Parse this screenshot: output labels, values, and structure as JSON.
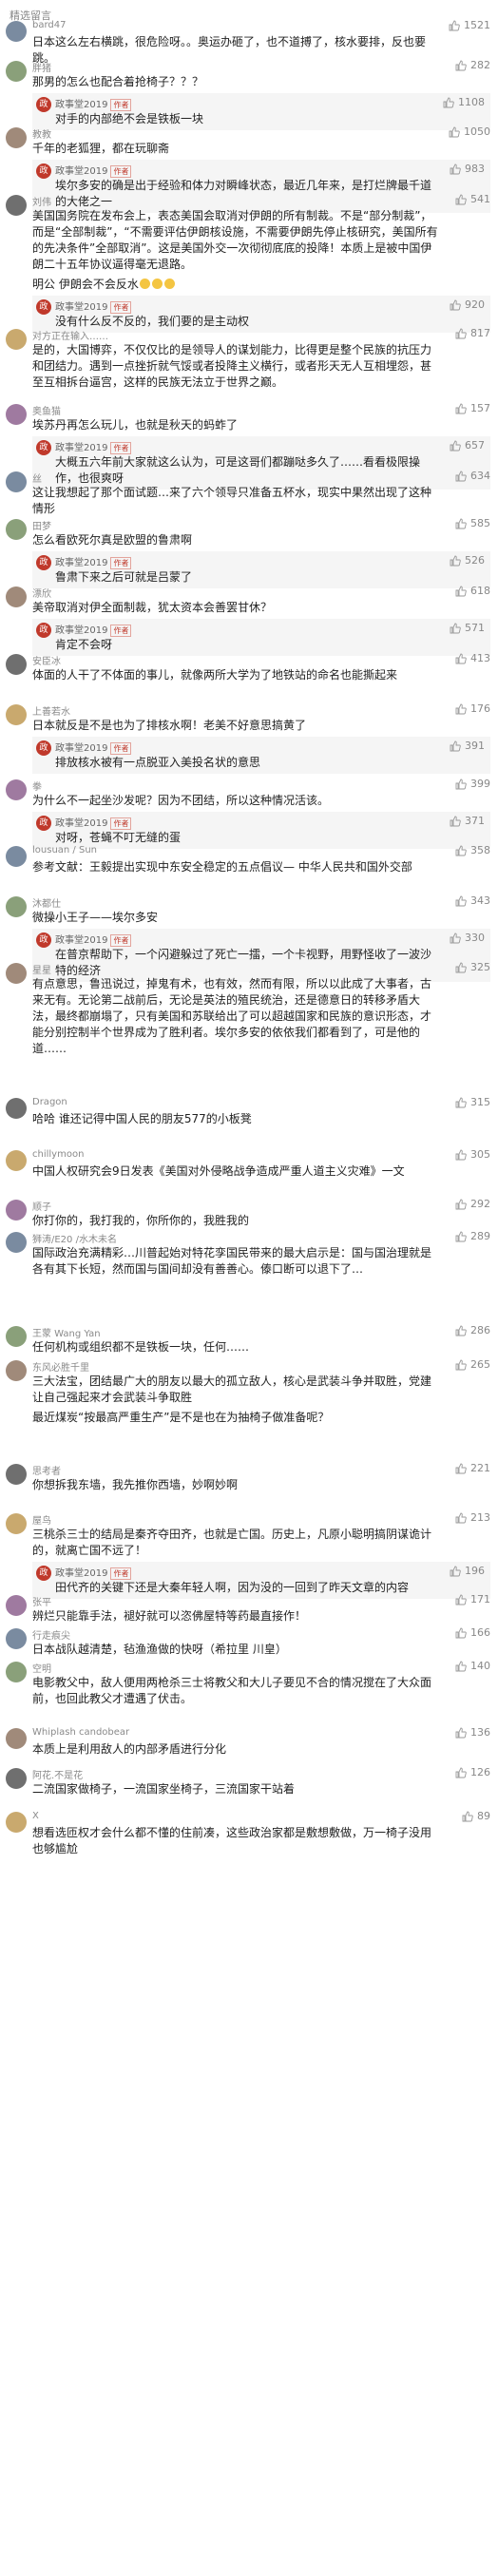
{
  "header": {
    "title": "精选留言"
  },
  "reply_author": {
    "name": "政事堂2019",
    "badge": "作者",
    "avatar_glyph": "政"
  },
  "icons": {
    "like": "thumb-up-icon",
    "emoji": "laugh-emoji"
  },
  "comments": [
    {
      "user": "bard47",
      "likes": "1521",
      "text": "日本这么左右横跳，很危险呀。。奥运办砸了，也不道搏了，核水要排，反也要跳。"
    },
    {
      "user": "胖猪",
      "likes": "282",
      "text": "那男的怎么也配合着抢椅子？？？",
      "reply": {
        "likes": "1108",
        "text": "对手的内部绝不会是铁板一块"
      }
    },
    {
      "user": "教教",
      "likes": "1050",
      "text": "千年的老狐狸，都在玩聊斋",
      "reply": {
        "likes": "983",
        "text": "埃尔多安的确是出于经验和体力对瞬峰状态，最近几年来，是打烂牌最千道的大佬之一"
      }
    },
    {
      "user": "刘伟",
      "likes": "541",
      "text": "美国国务院在发布会上，表态美国会取消对伊朗的所有制裁。不是“部分制裁”，而是“全部制裁”，“不需要评估伊朗核设施，不需要伊朗先停止核研究，美国所有的先决条件”全部取消”。这是美国外交一次彻彻底底的投降！本质上是被中国伊朗二十五年协议逼得毫无退路。",
      "text2": "明公  伊朗会不会反水",
      "reply": {
        "likes": "920",
        "text": "没有什么反不反的，我们要的是主动权"
      }
    },
    {
      "user": "对方正在输入……",
      "likes": "817",
      "text": "是的，大国博弈，不仅仅比的是领导人的谋划能力，比得更是整个民族的抗压力和团结力。遇到一点挫折就气馁或者投降主义横行，或者形天无人互相埋怨，甚至互相拆台逼宫，这样的民族无法立于世界之巅。"
    },
    {
      "user": "奥鱼猫",
      "likes": "157",
      "text": "埃苏丹再怎么玩儿，也就是秋天的蚂蚱了",
      "reply": {
        "likes": "657",
        "text": "大概五六年前大家就这么认为，可是这哥们都蹦哒多久了……看看极限操作，也很爽呀"
      }
    },
    {
      "user": "丝",
      "likes": "634",
      "text": "这让我想起了那个面试题…来了六个领导只准备五杯水，现实中果然出现了这种情形"
    },
    {
      "user": "田梦",
      "likes": "585",
      "text": "怎么看欧死尔真是欧盟的鲁肃啊",
      "reply": {
        "likes": "526",
        "text": "鲁肃下来之后可就是吕蒙了"
      }
    },
    {
      "user": "漂欣",
      "likes": "618",
      "text": "美帝取消对伊全面制裁，犹太资本会善罢甘休？",
      "reply": {
        "likes": "571",
        "text": "肯定不会呀"
      }
    },
    {
      "user": "安臣冰",
      "likes": "413",
      "text": "体面的人干了不体面的事儿，就像两所大学为了地铁站的命名也能撕起来"
    },
    {
      "user": "上善若水",
      "likes": "176",
      "text": "日本就反是不是也为了排核水啊！老美不好意思搞黄了",
      "reply": {
        "likes": "391",
        "text": "排放核水被有一点脱亚入美投名状的意思"
      }
    },
    {
      "user": "拳",
      "likes": "399",
      "text": "为什么不一起坐沙发呢？因为不团结，所以这种情况活该。",
      "reply": {
        "likes": "371",
        "text": "对呀，苍蝇不叮无缝的蛋"
      }
    },
    {
      "user": "lousuan / Sun",
      "likes": "358",
      "text": "参考文献：王毅提出实现中东安全稳定的五点倡议— 中华人民共和国外交部"
    },
    {
      "user": "沐都仕",
      "likes": "343",
      "text": "微操小王子——埃尔多安",
      "reply": {
        "likes": "330",
        "text": "在普京帮助下，一个闪避躲过了死亡一擂，一个卡视野，用野怪收了一波沙特的经济"
      }
    },
    {
      "user": "星星",
      "likes": "325",
      "text": "有点意思，鲁迅说过，掉鬼有术，也有效，然而有限，所以以此成了大事者，古来无有。无论第二战前后，无论是英法的殖民统治，还是德意日的转移矛盾大法，最终都崩塌了，只有美国和苏联给出了可以超越国家和民族的意识形态，才能分别控制半个世界成为了胜利者。埃尔多安的依依我们都看到了，可是他的道……"
    },
    {
      "user": "Dragon",
      "likes": "315",
      "text": "哈哈 谁还记得中国人民的朋友577的小板凳"
    },
    {
      "user": "chillymoon",
      "likes": "305",
      "text": "中国人权研究会9日发表《美国对外侵略战争造成严重人道主义灾难》一文"
    },
    {
      "user": "顺子",
      "likes": "292",
      "text": "你打你的，我打我的，你所你的，我胜我的"
    },
    {
      "user": "狮涛/E20 /水木未名",
      "likes": "289",
      "text": "国际政治充满精彩…川普起始对特花孪国民带来的最大启示是：国与国治理就是各有其下长短，然而国与国间却没有善善心。傣口断可以退下了…"
    },
    {
      "user": "王蒙 Wang Yan",
      "likes": "286",
      "text": "任何机构或组织都不是铁板一块，任何……"
    },
    {
      "user": "东风必胜千里",
      "likes": "265",
      "text": "三大法宝，团结最广大的朋友以最大的孤立敌人，核心是武装斗争并取胜，党建让自己强起来才会武装斗争取胜",
      "text2": "最近煤炭“按最高严重生产”是不是也在为抽椅子做准备呢？"
    },
    {
      "user": "思考者",
      "likes": "221",
      "text": "你想拆我东墙，我先推你西墙，妙啊妙啊"
    },
    {
      "user": "屋鸟",
      "likes": "213",
      "text": "三桃杀三士的结局是秦齐夺田齐，也就是亡国。历史上，凡原小聪明搞阴谋诡计的，就离亡国不远了！",
      "reply": {
        "likes": "196",
        "text": "田代齐的关键下还是大秦年轻人啊，因为没的一回到了昨天文章的内容"
      }
    },
    {
      "user": "张平",
      "likes": "171",
      "text": "辨烂只能靠手法，褪好就可以恣佛屋特等药最直接作！"
    },
    {
      "user": "行走痕尖",
      "likes": "166",
      "text": "日本战队越清楚，毡渔渔做的快呀（希拉里 川皇）"
    },
    {
      "user": "空明",
      "likes": "140",
      "text": "电影教父中，敌人便用两枪杀三士将教父和大儿子要见不合的情况搅在了大众面前，也回此教父才遭遇了伏击。"
    },
    {
      "user": "Whiplash candobear",
      "likes": "136",
      "text": "本质上是利用敌人的内部矛盾进行分化"
    },
    {
      "user": "阿花.不是花",
      "likes": "126",
      "text": "二流国家做椅子，一流国家坐椅子，三流国家干站着"
    },
    {
      "user": "X",
      "likes": "89",
      "text": "想看选匝权才会什么都不懂的住前凑，这些政治家都是敷想敷做，万一椅子没用也够尴尬"
    }
  ]
}
